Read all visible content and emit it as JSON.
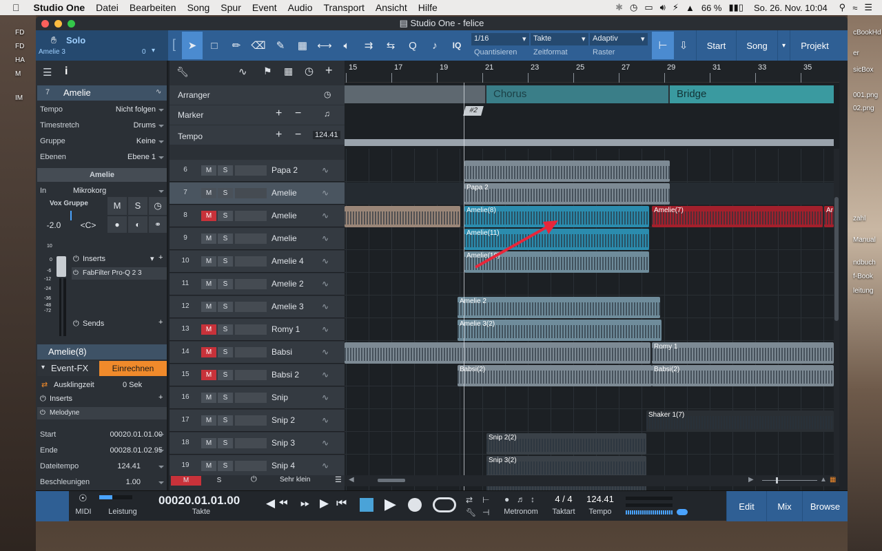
{
  "menubar": {
    "app": "Studio One",
    "items": [
      "Datei",
      "Bearbeiten",
      "Song",
      "Spur",
      "Event",
      "Audio",
      "Transport",
      "Ansicht",
      "Hilfe"
    ],
    "battery": "66 %",
    "datetime": "So. 26. Nov.  10:04"
  },
  "desktop": {
    "left_labels": [
      "FD",
      "FD",
      "HA",
      "M",
      "IM"
    ],
    "right_labels": [
      "cBookHd",
      "er",
      "sicBox",
      "001.png",
      "02.png",
      "zahl",
      "Manual",
      "ndbuch",
      "f-Book",
      "leitung"
    ]
  },
  "window": {
    "title": "Studio One - felice"
  },
  "toolbar": {
    "mode_label": "Solo",
    "track_label": "Amelie 3",
    "track_value": "0",
    "quantize_value": "1/16",
    "quantize_label": "Quantisieren",
    "timeformat_value": "Takte",
    "timeformat_label": "Zeitformat",
    "snap_value": "Adaptiv",
    "snap_label": "Raster",
    "iq_label": "IQ",
    "nav": [
      "Start",
      "Song",
      "Projekt"
    ]
  },
  "inspector": {
    "track_number": "7",
    "track_name": "Amelie",
    "rows": [
      {
        "k": "Tempo",
        "v": "Nicht folgen"
      },
      {
        "k": "Timestretch",
        "v": "Drums"
      },
      {
        "k": "Gruppe",
        "v": "Keine"
      },
      {
        "k": "Ebenen",
        "v": "Ebene 1"
      }
    ],
    "channel_name": "Amelie",
    "input_label": "In",
    "input_value": "Mikrokorg",
    "group_label": "Vox Gruppe",
    "volume": "-2.0",
    "pan": "<C>",
    "m_label": "M",
    "s_label": "S",
    "inserts_label": "Inserts",
    "plugin": "FabFilter Pro-Q 2 3",
    "sends_label": "Sends",
    "meter_scale": [
      "10",
      "0",
      "-6",
      "-12",
      "-24",
      "-36",
      "-48",
      "-72"
    ],
    "event_name": "Amelie(8)",
    "event_fx_label": "Event-FX",
    "render_button": "Einrechnen",
    "tail_label": "Ausklingzeit",
    "tail_value": "0 Sek",
    "event_inserts_label": "Inserts",
    "melodyne": "Melodyne",
    "props": [
      {
        "k": "Start",
        "v": "00020.01.01.00"
      },
      {
        "k": "Ende",
        "v": "00028.01.02.95"
      },
      {
        "k": "Dateitempo",
        "v": "124.41"
      },
      {
        "k": "Beschleunigen",
        "v": "1.00"
      }
    ]
  },
  "globaltracks": {
    "arranger": "Arranger",
    "marker": "Marker",
    "tempo": "Tempo",
    "tempo_value": "124.41",
    "sections": [
      "Chorus",
      "Bridge"
    ],
    "marker_tag": "#2"
  },
  "ruler": [
    "15",
    "17",
    "19",
    "21",
    "23",
    "25",
    "27",
    "29",
    "31",
    "33",
    "35"
  ],
  "tracks": [
    {
      "num": "6",
      "name": "Papa 2",
      "muted": false
    },
    {
      "num": "7",
      "name": "Amelie",
      "muted": false,
      "selected": true
    },
    {
      "num": "8",
      "name": "Amelie",
      "muted": true
    },
    {
      "num": "9",
      "name": "Amelie",
      "muted": false
    },
    {
      "num": "10",
      "name": "Amelie 4",
      "muted": false
    },
    {
      "num": "11",
      "name": "Amelie 2",
      "muted": false
    },
    {
      "num": "12",
      "name": "Amelie 3",
      "muted": false
    },
    {
      "num": "13",
      "name": "Romy 1",
      "muted": true
    },
    {
      "num": "14",
      "name": "Babsi",
      "muted": true
    },
    {
      "num": "15",
      "name": "Babsi 2",
      "muted": true
    },
    {
      "num": "16",
      "name": "Snip",
      "muted": false
    },
    {
      "num": "17",
      "name": "Snip 2",
      "muted": false
    },
    {
      "num": "18",
      "name": "Snip 3",
      "muted": false
    },
    {
      "num": "19",
      "name": "Snip 4",
      "muted": false
    }
  ],
  "clip_labels": [
    "Papa 2",
    "Amelie(8)",
    "Amelie(7)",
    "Ar",
    "Amelie(11)",
    "Amelie(10)",
    "Amelie 2",
    "Amelie 3(2)",
    "Romy 1",
    "Babsi(2)",
    "Babsi(2)",
    "Shaker 1(7)",
    "Snip 2(2)",
    "Snip 3(2)",
    "Snip 4(3)"
  ],
  "tracklist_footer": {
    "m": "M",
    "s": "S",
    "size": "Sehr klein"
  },
  "transport": {
    "midi": "MIDI",
    "perf": "Leistung",
    "position": "00020.01.01.00",
    "position_label": "Takte",
    "metronome": "Metronom",
    "signature": "4 / 4",
    "signature_label": "Taktart",
    "tempo": "124.41",
    "tempo_label": "Tempo",
    "views": [
      "Edit",
      "Mix",
      "Browse"
    ]
  },
  "colors": {
    "accent": "#2f5f94",
    "selected_clip": "#2b8cae",
    "red_clip": "#a3202c",
    "mute_on": "#c8323a",
    "arranger_section": "#3a8f99"
  }
}
